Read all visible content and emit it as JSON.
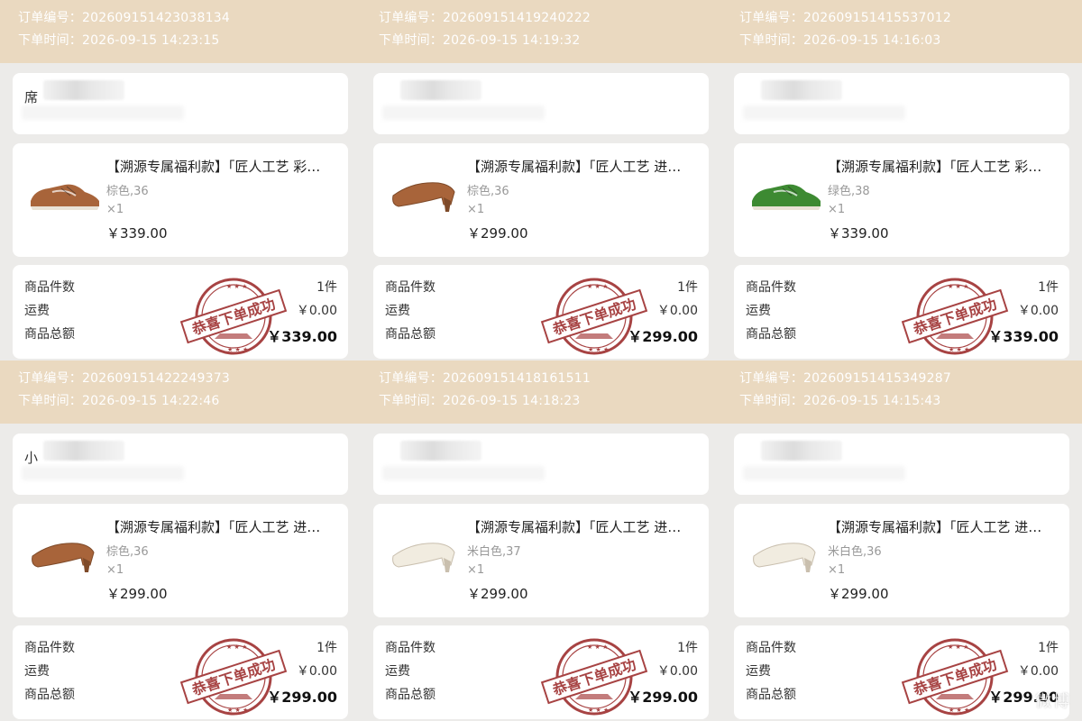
{
  "labels": {
    "order_no": "订单编号：",
    "order_time": "下单时间：",
    "count": "商品件数",
    "shipping": "运费",
    "total": "商品总额",
    "stamp_text": "恭喜下单成功"
  },
  "orders": [
    {
      "order_no": "20260915142303813​4",
      "order_time": "2026-09-15 14:23:15",
      "addr_visible": "席",
      "item": {
        "title": "【溯源专属福利款】「匠人工艺  彩…",
        "spec": "棕色,36",
        "qty": "×1",
        "price": "￥339.00",
        "shoe_icon": "sneaker-brown-icon"
      },
      "summary": {
        "count": "1件",
        "shipping": "￥0.00",
        "total": "￥339.00"
      }
    },
    {
      "order_no": "20260915141924022​2",
      "order_time": "2026-09-15 14:19:32",
      "addr_visible": "",
      "item": {
        "title": "【溯源专属福利款】「匠人工艺  进…",
        "spec": "棕色,36",
        "qty": "×1",
        "price": "￥299.00",
        "shoe_icon": "pump-brown-icon"
      },
      "summary": {
        "count": "1件",
        "shipping": "￥0.00",
        "total": "￥299.00"
      }
    },
    {
      "order_no": "20260915141553701​2",
      "order_time": "2026-09-15 14:16:03",
      "addr_visible": "",
      "item": {
        "title": "【溯源专属福利款】「匠人工艺  彩…",
        "spec": "绿色,38",
        "qty": "×1",
        "price": "￥339.00",
        "shoe_icon": "sneaker-green-icon"
      },
      "summary": {
        "count": "1件",
        "shipping": "￥0.00",
        "total": "￥339.00"
      }
    },
    {
      "order_no": "20260915142224937​3",
      "order_time": "2026-09-15 14:22:46",
      "addr_visible": "小",
      "item": {
        "title": "【溯源专属福利款】「匠人工艺  进…",
        "spec": "棕色,36",
        "qty": "×1",
        "price": "￥299.00",
        "shoe_icon": "pump-brown-icon"
      },
      "summary": {
        "count": "1件",
        "shipping": "￥0.00",
        "total": "￥299.00"
      }
    },
    {
      "order_no": "20260915141816151​1",
      "order_time": "2026-09-15 14:18:23",
      "addr_visible": "",
      "item": {
        "title": "【溯源专属福利款】「匠人工艺  进…",
        "spec": "米白色,37",
        "qty": "×1",
        "price": "￥299.00",
        "shoe_icon": "pump-cream-icon"
      },
      "summary": {
        "count": "1件",
        "shipping": "￥0.00",
        "total": "￥299.00"
      }
    },
    {
      "order_no": "20260915141534928​7",
      "order_time": "2026-09-15 14:15:43",
      "addr_visible": "",
      "item": {
        "title": "【溯源专属福利款】「匠人工艺  进…",
        "spec": "米白色,36",
        "qty": "×1",
        "price": "￥299.00",
        "shoe_icon": "pump-cream-icon"
      },
      "summary": {
        "count": "1件",
        "shipping": "￥0.00",
        "total": "￥299.00"
      }
    }
  ],
  "colors": {
    "header_band": "#ead9c0",
    "page_bg": "#ecebe9",
    "stamp_red": "#9c2a2a",
    "brown_shoe": "#a8643a",
    "green_shoe": "#3d8a32",
    "cream_shoe": "#f1ece0"
  },
  "watermark": "微博"
}
